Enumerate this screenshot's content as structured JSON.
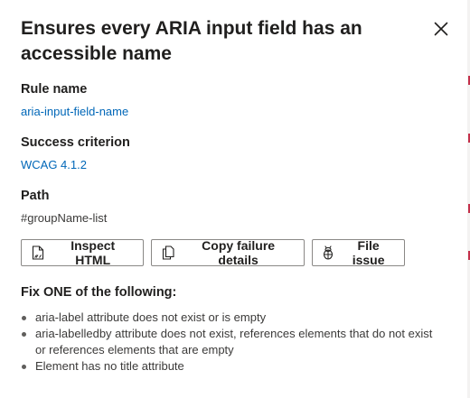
{
  "panel": {
    "title": "Ensures every ARIA input field has an accessible name"
  },
  "rule_name": {
    "label": "Rule name",
    "value": "aria-input-field-name"
  },
  "success_criterion": {
    "label": "Success criterion",
    "value": "WCAG 4.1.2"
  },
  "path": {
    "label": "Path",
    "value": "#groupName-list"
  },
  "actions": {
    "inspect_html": "Inspect HTML",
    "copy_failure_details": "Copy failure details",
    "file_issue": "File issue"
  },
  "fix": {
    "heading": "Fix ONE of the following:",
    "items": [
      "aria-label attribute does not exist or is empty",
      "aria-labelledby attribute does not exist, references elements that do not exist or references elements that are empty",
      "Element has no title attribute"
    ]
  },
  "colors": {
    "link": "#0067b8",
    "text": "#201f1e",
    "border": "#8a8886",
    "edge_mark": "#c4314b"
  },
  "icons": {
    "close": "close-icon",
    "inspect": "inspect-html-icon",
    "copy": "copy-icon",
    "file_issue": "bug-icon"
  }
}
